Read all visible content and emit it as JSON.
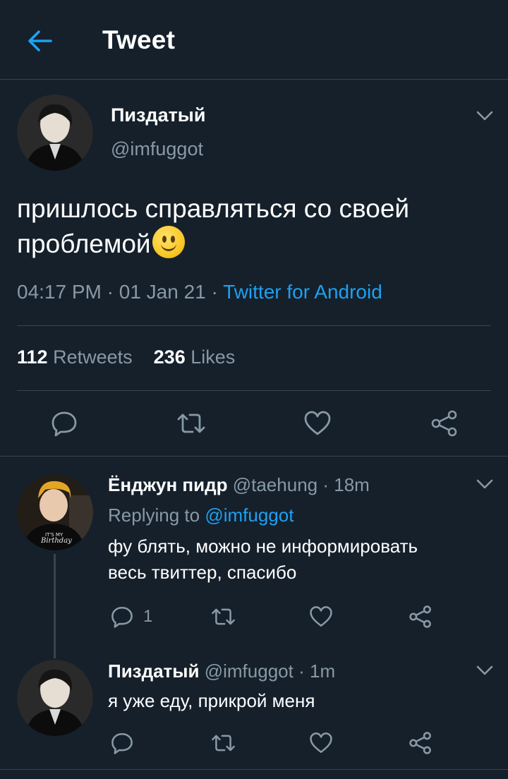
{
  "header": {
    "title": "Tweet",
    "back_icon": "back-arrow-icon"
  },
  "main_tweet": {
    "author_name": "Пиздатый",
    "author_handle": "@imfuggot",
    "text": "пришлось справляться со своей проблемой",
    "emoji": "slightly-smiling-face",
    "time": "04:17 PM",
    "date": "01 Jan 21",
    "source": "Twitter for Android",
    "retweets_count": "112",
    "retweets_label": "Retweets",
    "likes_count": "236",
    "likes_label": "Likes",
    "actions": [
      "reply-icon",
      "retweet-icon",
      "like-icon",
      "share-icon"
    ]
  },
  "replies": [
    {
      "author_name": "Ёнджун пидр",
      "author_handle": "@taehung",
      "time": "18m",
      "replying_label": "Replying to",
      "replying_handle": "@imfuggot",
      "text_line1": "фу блять, можно не информировать",
      "text_line2": "весь твиттер, спасибо",
      "reply_count": "1"
    },
    {
      "author_name": "Пиздатый",
      "author_handle": "@imfuggot",
      "time": "1m",
      "text_line1": "я уже еду, прикрой меня"
    }
  ],
  "colors": {
    "background": "#15202b",
    "separator": "#38444d",
    "muted_text": "#8899a6",
    "accent": "#1da1f2"
  }
}
